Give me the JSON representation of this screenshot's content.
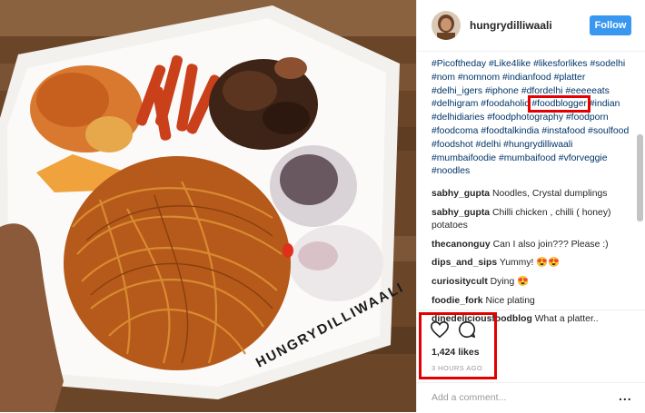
{
  "photo": {
    "watermark": "HUNGRYDILLIWAALI",
    "description_icon": "food-plate-photo"
  },
  "header": {
    "username": "hungrydilliwaali",
    "follow_label": "Follow"
  },
  "caption": {
    "tags": [
      "#Picoftheday",
      "#Like4like",
      "#likesforlikes",
      "#sodelhi",
      "#nom",
      "#nomnom",
      "#indianfood",
      "#platter",
      "#delhi_igers",
      "#iphone",
      "#dfordelhi",
      "#eeeeeats",
      "#delhigram",
      "#foodaholic",
      "#foodblogger",
      "#indian",
      "#delhidiaries",
      "#foodphotography",
      "#foodporn",
      "#foodcoma",
      "#foodtalkindia",
      "#instafood",
      "#soulfood",
      "#foodshot",
      "#delhi",
      "#hungrydilliwaali",
      "#mumbaifoodie",
      "#mumbaifood",
      "#vforveggie",
      "#noodles"
    ],
    "highlighted_tag": "#foodblogger"
  },
  "comments": [
    {
      "user": "sabhy_gupta",
      "text": "Noodles, Crystal dumplings"
    },
    {
      "user": "sabhy_gupta",
      "text": "Chilli chicken , chilli ( honey) potatoes"
    },
    {
      "user": "thecanonguy",
      "text": "Can I also join??? Please :)"
    },
    {
      "user": "dips_and_sips",
      "text": "Yummy! 😍😍"
    },
    {
      "user": "curiositycult",
      "text": "Dying 😍"
    },
    {
      "user": "foodie_fork",
      "text": "Nice plating"
    },
    {
      "user": "dinedeliciousfoodblog",
      "text": "What a platter.."
    }
  ],
  "actions": {
    "likes": "1,424 likes",
    "time": "3 HOURS AGO"
  },
  "add_comment": {
    "placeholder": "Add a comment...",
    "more": "..."
  },
  "colors": {
    "accent": "#3897f0",
    "highlight": "#e30000",
    "hashtag": "#003569"
  }
}
